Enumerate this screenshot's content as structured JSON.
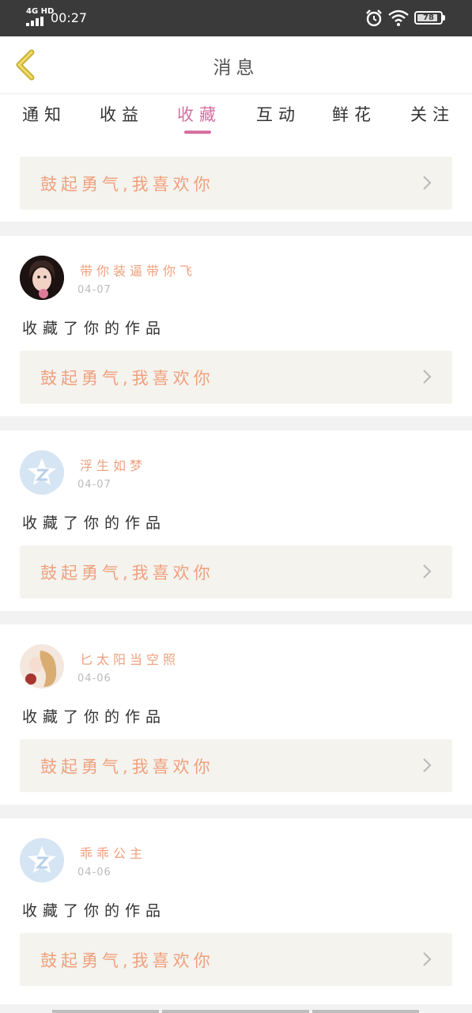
{
  "status_bar": {
    "network": "4G HD",
    "time": "00:27",
    "battery": "78"
  },
  "header": {
    "title": "消息",
    "back_icon": "chevron-left-icon"
  },
  "tabs": [
    {
      "label": "通知"
    },
    {
      "label": "收益"
    },
    {
      "label": "收藏"
    },
    {
      "label": "互动"
    },
    {
      "label": "鲜花"
    },
    {
      "label": "关注"
    }
  ],
  "active_tab": "收藏",
  "colors": {
    "accent_pink": "#d6709f",
    "username_orange": "#f0a07e",
    "work_box_bg": "#f4f3ee"
  },
  "partial_card": {
    "work_title": "鼓起勇气,我喜欢你"
  },
  "messages": [
    {
      "username": "带你装逼带你飞",
      "date": "04-07",
      "action": "收藏了你的作品",
      "work_title": "鼓起勇气,我喜欢你",
      "avatar": "photo-avatar"
    },
    {
      "username": "浮生如梦",
      "date": "04-07",
      "action": "收藏了你的作品",
      "work_title": "鼓起勇气,我喜欢你",
      "avatar": "default-avatar"
    },
    {
      "username": "匕太阳当空照",
      "date": "04-06",
      "action": "收藏了你的作品",
      "work_title": "鼓起勇气,我喜欢你",
      "avatar": "photo-avatar"
    },
    {
      "username": "乖乖公主",
      "date": "04-06",
      "action": "收藏了你的作品",
      "work_title": "鼓起勇气,我喜欢你",
      "avatar": "default-avatar"
    }
  ]
}
